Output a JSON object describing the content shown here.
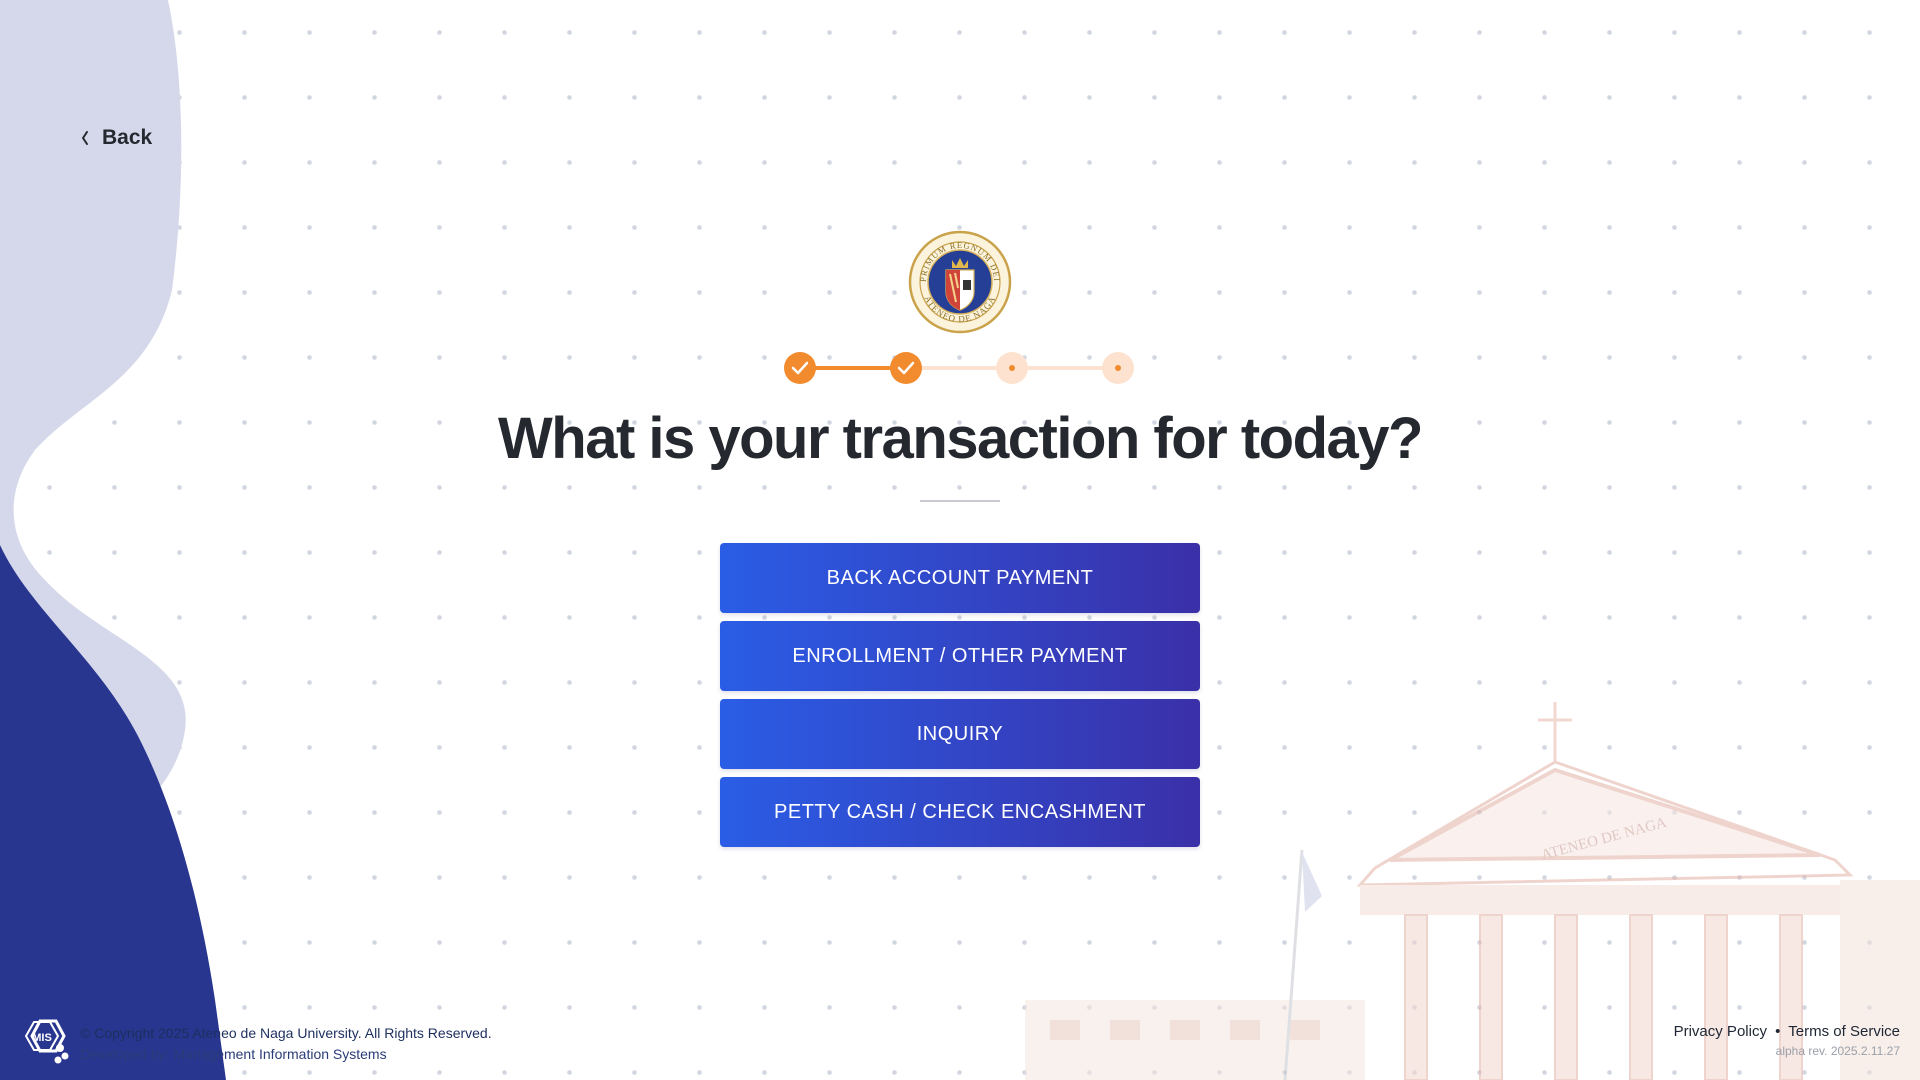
{
  "nav": {
    "back_label": "Back"
  },
  "stepper": {
    "current_step": 3,
    "total_steps": 4,
    "completed_steps": 2
  },
  "title": "What is your transaction for today?",
  "options": [
    "BACK ACCOUNT PAYMENT",
    "ENROLLMENT / OTHER PAYMENT",
    "INQUIRY",
    "PETTY CASH / CHECK ENCASHMENT"
  ],
  "seal": {
    "motto": "PRIMUM REGNUM DEI",
    "name": "ATENEO DE NAGA"
  },
  "building_inscription": "ATENEO DE NAGA",
  "footer": {
    "logo_text": "MIS",
    "copyright": "© Copyright 2025 Ateneo de Naga University. All Rights Reserved.",
    "developer": "Developed by: Management Information Systems",
    "privacy": "Privacy Policy",
    "separator": "•",
    "terms": "Terms of Service",
    "version": "alpha rev. 2025.2.11.27"
  },
  "colors": {
    "primary_gradient_start": "#2a5de6",
    "primary_gradient_end": "#3a30a8",
    "step_active": "#f28a2e",
    "step_pending": "#fde3cf",
    "wave_light": "#d5d8ea",
    "wave_dark": "#28368f",
    "title_text": "#25292f"
  }
}
